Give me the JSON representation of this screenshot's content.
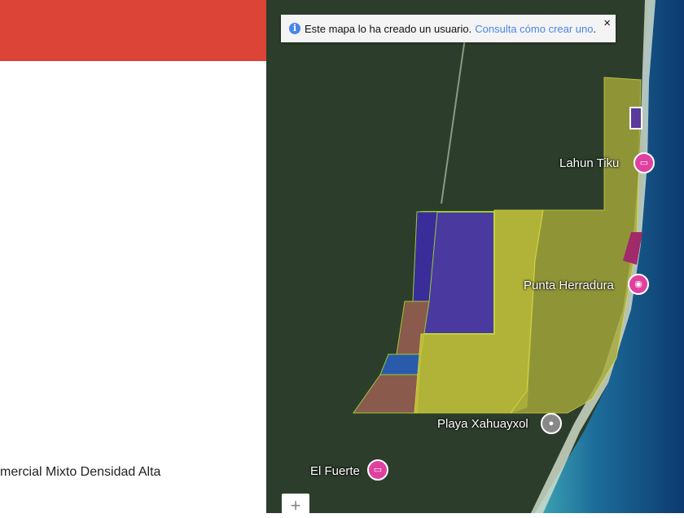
{
  "sidebar": {
    "description": "mercial Mixto Densidad Alta"
  },
  "notice": {
    "text": "Este mapa lo ha creado un usuario.",
    "link": "Consulta cómo crear uno",
    "suffix": ".",
    "close": "×",
    "info": "i"
  },
  "places": [
    {
      "name": "Lahun Tiku",
      "icon": "hotel-icon",
      "color": "#e040a0"
    },
    {
      "name": "Punta Herradura",
      "icon": "camera-icon",
      "color": "#e040a0"
    },
    {
      "name": "Playa Xahuayxol",
      "icon": "pin-icon",
      "color": "#888888"
    },
    {
      "name": "El Fuerte",
      "icon": "hotel-icon",
      "color": "#e040a0"
    }
  ],
  "controls": {
    "zoom_in": "+"
  }
}
